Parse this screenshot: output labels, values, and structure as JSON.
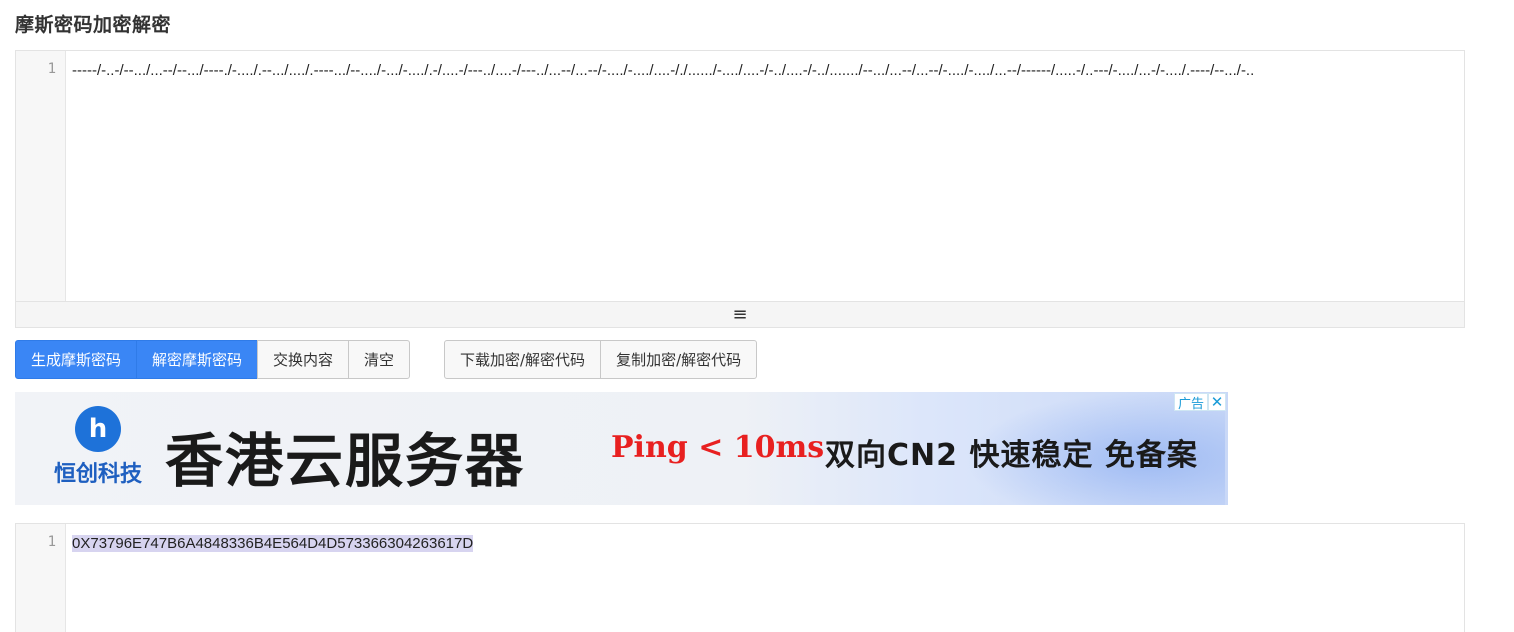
{
  "page": {
    "title": "摩斯密码加密解密"
  },
  "input_editor": {
    "line_number": "1",
    "content": "-----/-..-/--.../...--/--.../----./-..../.--.../..../.----.../--..../-.../-..../.-/....-/---../....-/---../...--/...--/-..../-..../....-/./....../-..../....-/-../....-/-../......./--.../...--/...--/-..../-..../...--/------/.....-/..---/-..../...-/-..../.----/--.../-..",
    "resize_icon": "≡"
  },
  "toolbar": {
    "group1": [
      {
        "label": "生成摩斯密码",
        "style": "primary"
      },
      {
        "label": "解密摩斯密码",
        "style": "primary"
      },
      {
        "label": "交换内容",
        "style": "default"
      },
      {
        "label": "清空",
        "style": "default"
      }
    ],
    "group2": [
      {
        "label": "下载加密/解密代码",
        "style": "default"
      },
      {
        "label": "复制加密/解密代码",
        "style": "default"
      }
    ]
  },
  "ad": {
    "logo_text": "恒创科技",
    "logo_mark": "h",
    "headline": "香港云服务器",
    "ping": "Ping < 10ms",
    "features": "双向CN2 快速稳定 免备案",
    "tag_label": "广告",
    "close_icon": "✕"
  },
  "output_editor": {
    "line_number": "1",
    "content": "0X73796E747B6A4848336B4E564D4D573366304263617D"
  },
  "colors": {
    "primary_button": "#3a86f5",
    "ad_red": "#e82020",
    "selection": "#d7d4f0"
  }
}
